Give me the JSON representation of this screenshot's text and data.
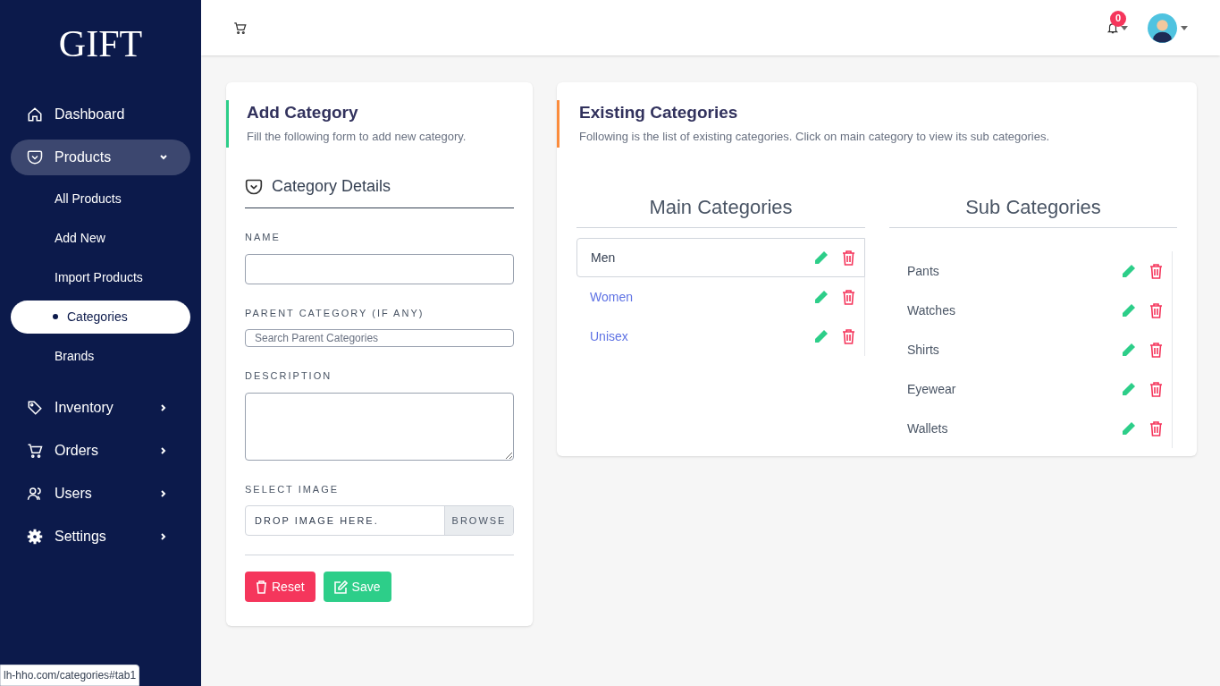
{
  "sidebar": {
    "logo": "GIFT",
    "items": [
      {
        "label": "Dashboard",
        "selected": false
      },
      {
        "label": "Products",
        "selected": true,
        "expanded": true,
        "children": [
          {
            "label": "All Products",
            "selected": false
          },
          {
            "label": "Add New",
            "selected": false
          },
          {
            "label": "Import Products",
            "selected": false
          },
          {
            "label": "Categories",
            "selected": true
          },
          {
            "label": "Brands",
            "selected": false
          }
        ]
      },
      {
        "label": "Inventory",
        "selected": false,
        "expanded": false
      },
      {
        "label": "Orders",
        "selected": false,
        "expanded": false
      },
      {
        "label": "Users",
        "selected": false,
        "expanded": false
      },
      {
        "label": "Settings",
        "selected": false,
        "expanded": false
      }
    ]
  },
  "header": {
    "notification_count": "0"
  },
  "add_category": {
    "title": "Add Category",
    "subtitle": "Fill the following form to add new category.",
    "section": "Category Details",
    "fields": [
      {
        "kind": "input",
        "label": "NAME"
      },
      {
        "kind": "input",
        "label": "PARENT CATEGORY (IF ANY)",
        "placeholder": "Search Parent Categories"
      },
      {
        "kind": "textarea",
        "label": "DESCRIPTION"
      },
      {
        "kind": "file",
        "label": "SELECT IMAGE",
        "placeholder": "DROP IMAGE HERE.",
        "button": "BROWSE"
      }
    ],
    "buttons": [
      {
        "kind": "reset",
        "label": "Reset"
      },
      {
        "kind": "save",
        "label": "Save"
      }
    ]
  },
  "existing": {
    "title": "Existing Categories",
    "subtitle": "Following is the list of existing categories. Click on main category to view its sub categories.",
    "main": {
      "heading": "Main Categories",
      "items": [
        {
          "label": "Men",
          "selected": true
        },
        {
          "label": "Women",
          "selected": false
        },
        {
          "label": "Unisex",
          "selected": false
        }
      ]
    },
    "sub": {
      "heading": "Sub Categories",
      "items": [
        {
          "label": "Pants"
        },
        {
          "label": "Watches"
        },
        {
          "label": "Shirts"
        },
        {
          "label": "Eyewear"
        },
        {
          "label": "Wallets"
        }
      ]
    }
  },
  "status_bar": "lh-hho.com/categories#tab1"
}
